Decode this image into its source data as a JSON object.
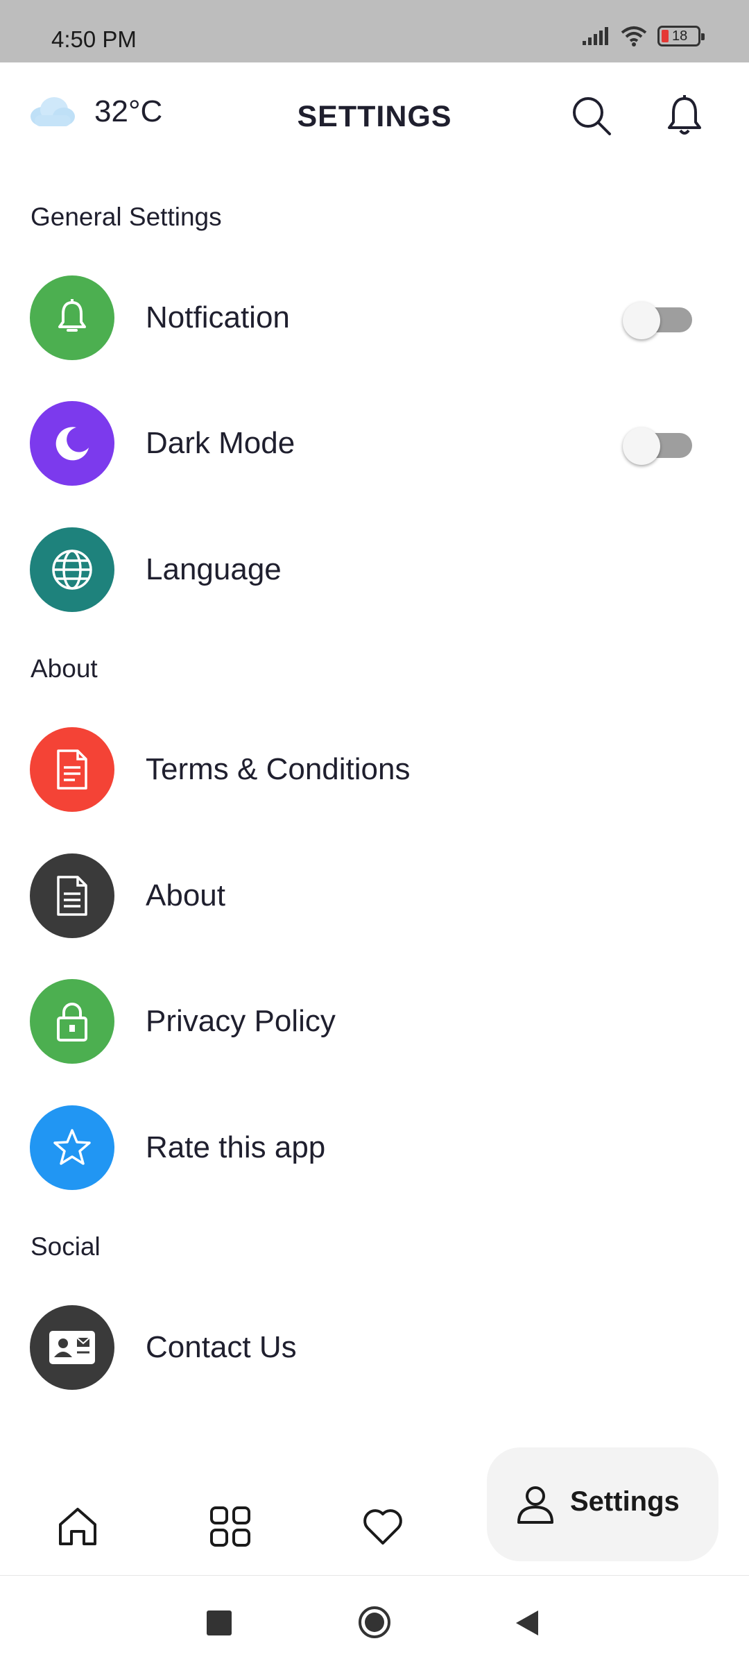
{
  "status_bar": {
    "time": "4:50 PM",
    "battery": "18"
  },
  "header": {
    "temperature": "32°C",
    "title": "SETTINGS"
  },
  "sections": [
    {
      "title": "General Settings",
      "items": [
        {
          "label": "Notfication",
          "icon": "bell-icon",
          "color": "#4caf50",
          "toggle": false
        },
        {
          "label": "Dark Mode",
          "icon": "moon-icon",
          "color": "#7c3aed",
          "toggle": false
        },
        {
          "label": "Language",
          "icon": "globe-icon",
          "color": "#1e827c"
        }
      ]
    },
    {
      "title": "About",
      "items": [
        {
          "label": "Terms & Conditions",
          "icon": "document-icon",
          "color": "#f44336"
        },
        {
          "label": "About",
          "icon": "document-icon",
          "color": "#3a3a3a"
        },
        {
          "label": "Privacy Policy",
          "icon": "lock-icon",
          "color": "#4caf50"
        },
        {
          "label": "Rate this app",
          "icon": "star-icon",
          "color": "#2196f3"
        }
      ]
    },
    {
      "title": "Social",
      "items": [
        {
          "label": "Contact Us",
          "icon": "contact-card-icon",
          "color": "#3a3a3a"
        }
      ]
    }
  ],
  "bottom_nav": {
    "active_label": "Settings",
    "items": [
      "home-icon",
      "grid-icon",
      "heart-icon",
      "person-icon"
    ]
  }
}
